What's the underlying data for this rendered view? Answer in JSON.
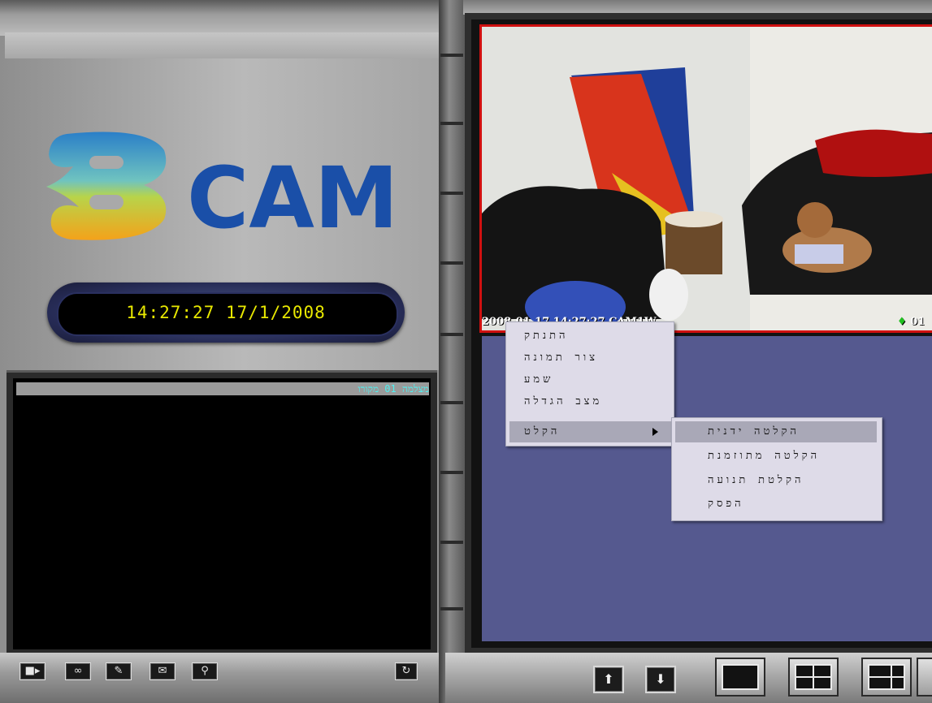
{
  "logo": {
    "mark": "8",
    "text": "CAM"
  },
  "clock": {
    "time": "14:27:27",
    "date": "17/1/2008"
  },
  "log_panel": {
    "header": "מצלמה 01 מקורו"
  },
  "video": {
    "overlay_left": "2008-01-17 14:27:27 CAM1W",
    "overlay_right": "01",
    "record_indicator_color": "#20c020"
  },
  "context_menu": {
    "items": [
      "התנתק",
      "צור תמונה",
      "שמע",
      "מצב הגדלה",
      "הקלט"
    ],
    "selected": "הקלט"
  },
  "record_submenu": {
    "items": [
      "הקלטה ידנית",
      "הקלטה מתוזמנת",
      "הקלטת תנועה",
      "הפסק"
    ],
    "selected": "הקלטה ידנית"
  },
  "toolbar_left": {
    "icons": [
      "camera-icon",
      "playback-icon",
      "settings-icon",
      "alarm-icon",
      "search-icon"
    ],
    "refresh_icon": "refresh-icon"
  },
  "toolbar_right": {
    "nav": [
      "page-up-icon",
      "page-down-icon"
    ],
    "layouts": [
      "layout-1-icon",
      "layout-4-icon",
      "layout-6-icon"
    ]
  },
  "colors": {
    "accent_red": "#d01010",
    "empty_view": "#55598f",
    "clock_text": "#e8e800",
    "log_header_text": "#4ff0f0"
  }
}
